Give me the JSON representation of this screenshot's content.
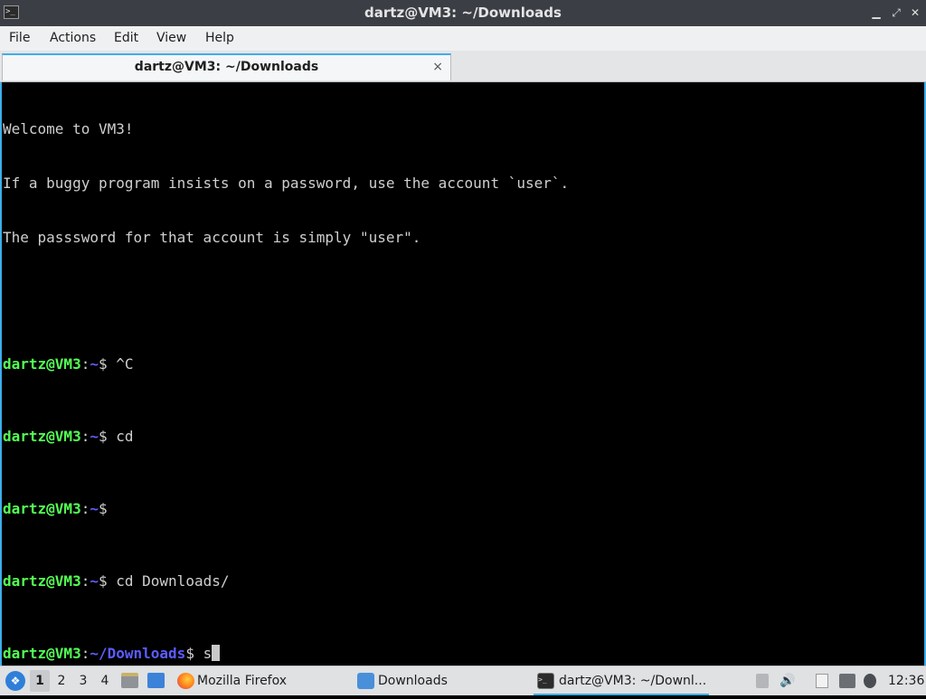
{
  "window": {
    "title": "dartz@VM3: ~/Downloads",
    "icon": "terminal-icon",
    "controls": [
      "minimize-icon",
      "maximize-icon",
      "close-icon"
    ]
  },
  "menu": {
    "file": "File",
    "actions": "Actions",
    "edit": "Edit",
    "view": "View",
    "help": "Help"
  },
  "tab": {
    "label": "dartz@VM3: ~/Downloads",
    "close_glyph": "×"
  },
  "terminal": {
    "welcome": [
      "Welcome to VM3!",
      "If a buggy program insists on a password, use the account `user`.",
      "The passsword for that account is simply \"user\"."
    ],
    "prompts": [
      {
        "user": "dartz@VM3",
        "sep": ":",
        "path": "~",
        "sym": "$ ",
        "cmd": "^C"
      },
      {
        "user": "dartz@VM3",
        "sep": ":",
        "path": "~",
        "sym": "$ ",
        "cmd": "cd"
      },
      {
        "user": "dartz@VM3",
        "sep": ":",
        "path": "~",
        "sym": "$ ",
        "cmd": ""
      },
      {
        "user": "dartz@VM3",
        "sep": ":",
        "path": "~",
        "sym": "$ ",
        "cmd": "cd Downloads/"
      },
      {
        "user": "dartz@VM3",
        "sep": ":",
        "path": "~/Downloads",
        "sym": "$ ",
        "cmd": "s"
      }
    ],
    "colors": {
      "user": "#54ff54",
      "path": "#5c5cff",
      "text": "#cfcfcf",
      "accent": "#3daee9"
    }
  },
  "taskbar": {
    "workspaces": [
      "1",
      "2",
      "3",
      "4"
    ],
    "active_workspace": "1",
    "tasks": {
      "firefox": "Mozilla Firefox",
      "downloads": "Downloads",
      "terminal": "dartz@VM3: ~/Downl..."
    },
    "clock": "12:36",
    "tray_icons": [
      "keyboard-layout-icon",
      "volume-icon",
      "clipboard-icon",
      "network-icon",
      "update-icon"
    ]
  }
}
